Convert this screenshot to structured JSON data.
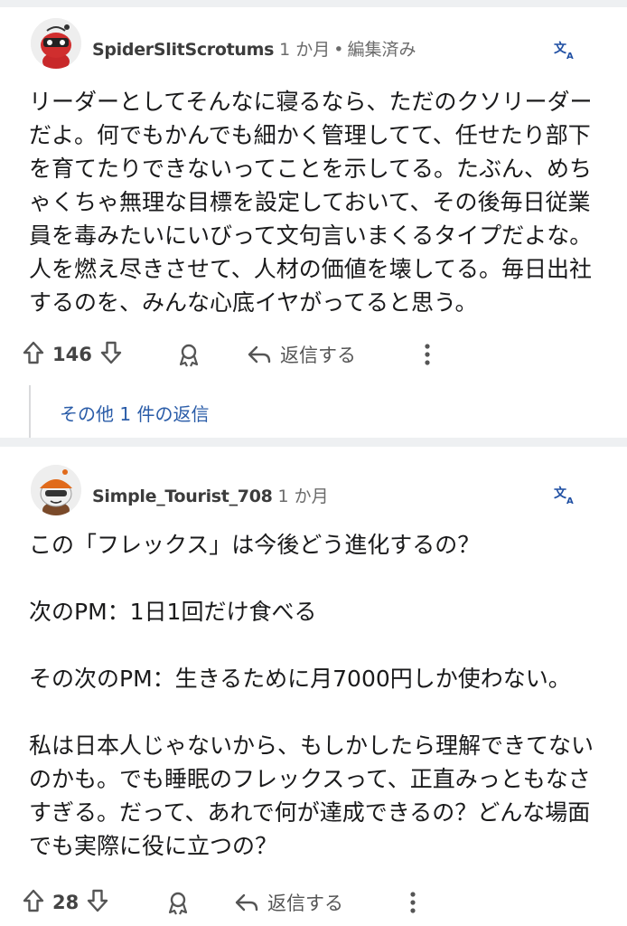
{
  "comments": [
    {
      "username": "SpiderSlitScrotums",
      "time": "1 か月",
      "separator": "•",
      "edited": "編集済み",
      "body": [
        "リーダーとしてそんなに寝るなら、ただのクソリーダーだよ。何でもかんでも細かく管理してて、任せたり部下を育てたりできないってことを示してる。たぶん、めちゃくちゃ無理な目標を設定しておいて、その後毎日従業員を毒みたいにいびって文句言いまくるタイプだよな。人を燃え尽きさせて、人材の価値を壊してる。毎日出社するのを、みんな心底イヤがってると思う。"
      ],
      "votes": "146",
      "reply_label": "返信する",
      "more_replies": "その他 1 件の返信"
    },
    {
      "username": "Simple_Tourist_708",
      "time": "1 か月",
      "body": [
        "この「フレックス」は今後どう進化するの？",
        "次のPM：1日1回だけ食べる",
        "その次のPM：生きるために月7000円しか使わない。",
        "私は日本人じゃないから、もしかしたら理解できてないのかも。でも睡眠のフレックスって、正直みっともなさすぎる。だって、あれで何が達成できるの？どんな場面でも実際に役に立つの？"
      ],
      "votes": "28",
      "reply_label": "返信する"
    }
  ],
  "icons": {
    "upvote": "arrow-up-icon",
    "downvote": "arrow-down-icon",
    "award": "award-icon",
    "reply": "reply-arrow-icon",
    "more": "more-vertical-icon",
    "translate": "translate-icon"
  },
  "colors": {
    "link": "#2a5ca8",
    "translate": "#1f4fa3",
    "separator_band": "#eef0f2"
  }
}
